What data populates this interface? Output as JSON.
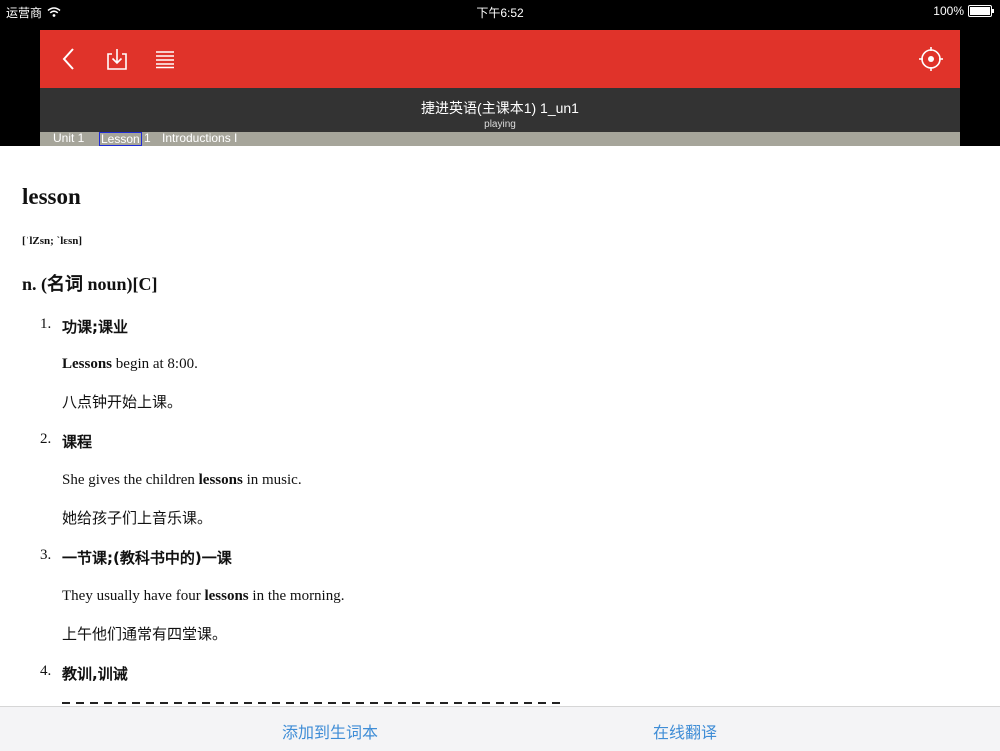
{
  "status_bar": {
    "carrier": "运营商",
    "time": "下午6:52",
    "battery": "100%",
    "icons": [
      "wifi-icon",
      "battery-icon"
    ]
  },
  "toolbar": {
    "color": "#e0332a",
    "icons": [
      "back-icon",
      "download-icon",
      "list-icon",
      "target-icon"
    ]
  },
  "player": {
    "title": "捷进英语(主课本1)  1_un1",
    "status": "playing"
  },
  "lesson_strip": {
    "unit": "Unit 1",
    "lesson_word": "Lesson",
    "lesson_num": "1",
    "topic": "Introductions I"
  },
  "dictionary": {
    "word": "lesson",
    "phonetic": "[ˈlZsn; ˋlɛsn]",
    "pos": "n. (名词 noun)[C]",
    "senses": [
      {
        "num": "1.",
        "definition": "功课;课业",
        "example_pre": "",
        "example_bold": "Lessons",
        "example_post": " begin at 8:00.",
        "translation": "八点钟开始上课。"
      },
      {
        "num": "2.",
        "definition": "课程",
        "example_pre": "She gives the children ",
        "example_bold": "lessons",
        "example_post": " in music.",
        "translation": "她给孩子们上音乐课。"
      },
      {
        "num": "3.",
        "definition": "一节课;(教科书中的)一课",
        "example_pre": "They usually have four ",
        "example_bold": "lessons",
        "example_post": " in the morning.",
        "translation": "上午他们通常有四堂课。"
      },
      {
        "num": "4.",
        "definition": "教训,训诫"
      }
    ]
  },
  "bottom_bar": {
    "add_to_vocab": "添加到生词本",
    "online_translate": "在线翻译",
    "accent": "#3f8dd6"
  }
}
